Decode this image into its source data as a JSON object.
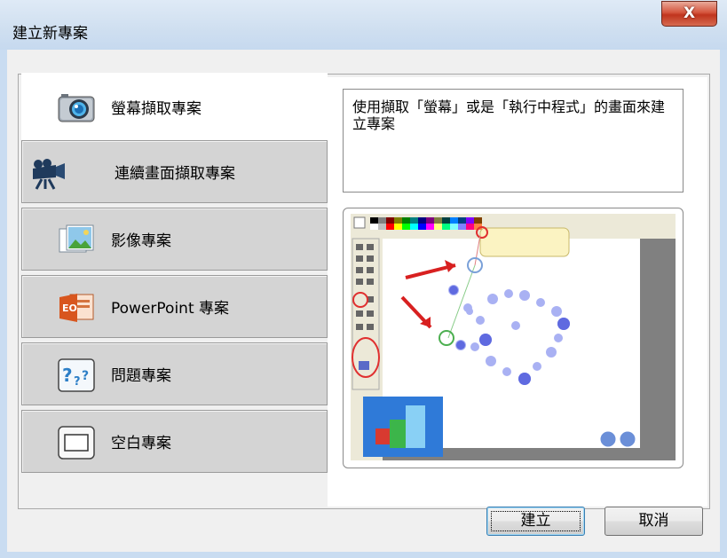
{
  "window": {
    "title": "建立新專案",
    "close_label": "X"
  },
  "tabs": [
    {
      "label": "螢幕擷取專案",
      "icon": "camera-icon",
      "active": true
    },
    {
      "label": "連續畫面擷取專案",
      "icon": "video-camera-icon",
      "active": false
    },
    {
      "label": "影像專案",
      "icon": "image-icon",
      "active": false
    },
    {
      "label": "PowerPoint 專案",
      "icon": "powerpoint-icon",
      "active": false
    },
    {
      "label": "問題專案",
      "icon": "question-icon",
      "active": false
    },
    {
      "label": "空白專案",
      "icon": "blank-page-icon",
      "active": false
    }
  ],
  "description": "使用擷取「螢幕」或是「執行中程式」的畫面來建立專案",
  "preview": {
    "alt": "screen-capture-preview"
  },
  "buttons": {
    "create": "建立",
    "cancel": "取消"
  },
  "colors": {
    "accent": "#3c7fb1",
    "close": "#c0341d"
  }
}
